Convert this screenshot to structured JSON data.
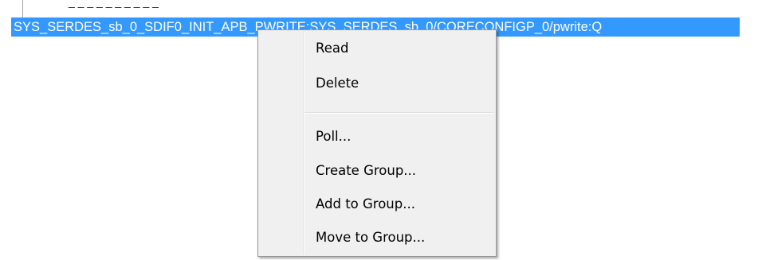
{
  "tree": {
    "previous_row_partial": "_ _ _ _ _ _ _ _ _ _",
    "selected_row_text": "SYS_SERDES_sb_0_SDIF0_INIT_APB_PWRITE:SYS_SERDES_sb_0/CORECONFIGP_0/pwrite:Q"
  },
  "context_menu": {
    "items": [
      {
        "label": "Read"
      },
      {
        "label": "Delete"
      },
      {
        "label": "Poll..."
      },
      {
        "label": "Create Group..."
      },
      {
        "label": "Add to Group..."
      },
      {
        "label": "Move to Group..."
      }
    ]
  },
  "colors": {
    "selection_bg": "#3399ff",
    "menu_bg": "#f0f0f0",
    "menu_border": "#979797"
  }
}
